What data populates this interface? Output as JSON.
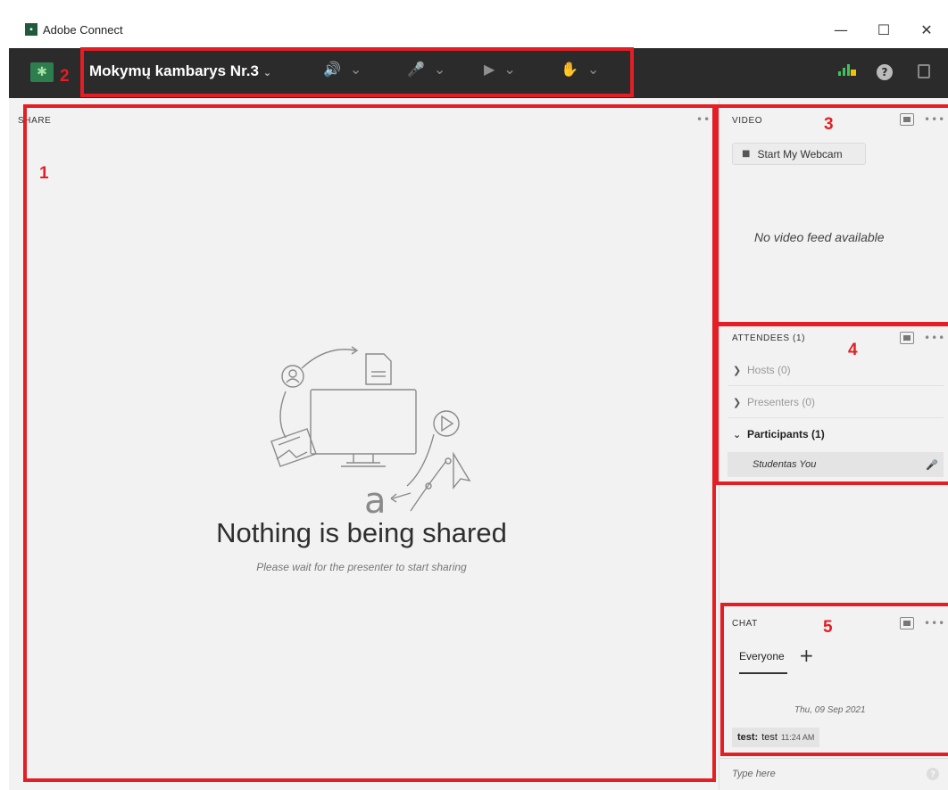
{
  "window": {
    "title": "Adobe Connect",
    "minimize_glyph": "—",
    "maximize_glyph": "☐",
    "close_glyph": "✕"
  },
  "toolbar": {
    "room_name": "Mokymų kambarys Nr.3",
    "icons": [
      "logo-icon",
      "speaker-icon",
      "microphone-icon",
      "camera-icon",
      "raise-hand-icon",
      "connection-bars-icon",
      "help-icon",
      "fullscreen-icon"
    ],
    "help_glyph": "?"
  },
  "share": {
    "title": "SHARE",
    "menu": "•••",
    "empty_heading": "Nothing is being shared",
    "empty_subtext": "Please wait for the presenter to start sharing"
  },
  "video": {
    "title": "VIDEO",
    "menu": "•••",
    "webcam_button": "Start My Webcam",
    "no_feed": "No video feed available"
  },
  "attendees": {
    "title": "ATTENDEES  (1)",
    "menu": "•••",
    "groups": [
      {
        "label": "Hosts (0)",
        "expanded": false
      },
      {
        "label": "Presenters (0)",
        "expanded": false
      },
      {
        "label": "Participants (1)",
        "expanded": true
      }
    ],
    "participant": "Studentas You"
  },
  "chat": {
    "title": "CHAT",
    "menu": "•••",
    "tab": "Everyone",
    "add_tab": "+",
    "date": "Thu, 09 Sep 2021",
    "message_sender": "test:",
    "message_text": "test",
    "message_time": "11:24 AM",
    "input_placeholder": "Type here"
  },
  "annotations": [
    "1",
    "2",
    "3",
    "4",
    "5"
  ],
  "colors": {
    "toolbar_bg": "#2b2b2b",
    "annotation_red": "#e31e24",
    "audio_green": "#3ec35a",
    "panel_bg": "#f2f2f2"
  }
}
